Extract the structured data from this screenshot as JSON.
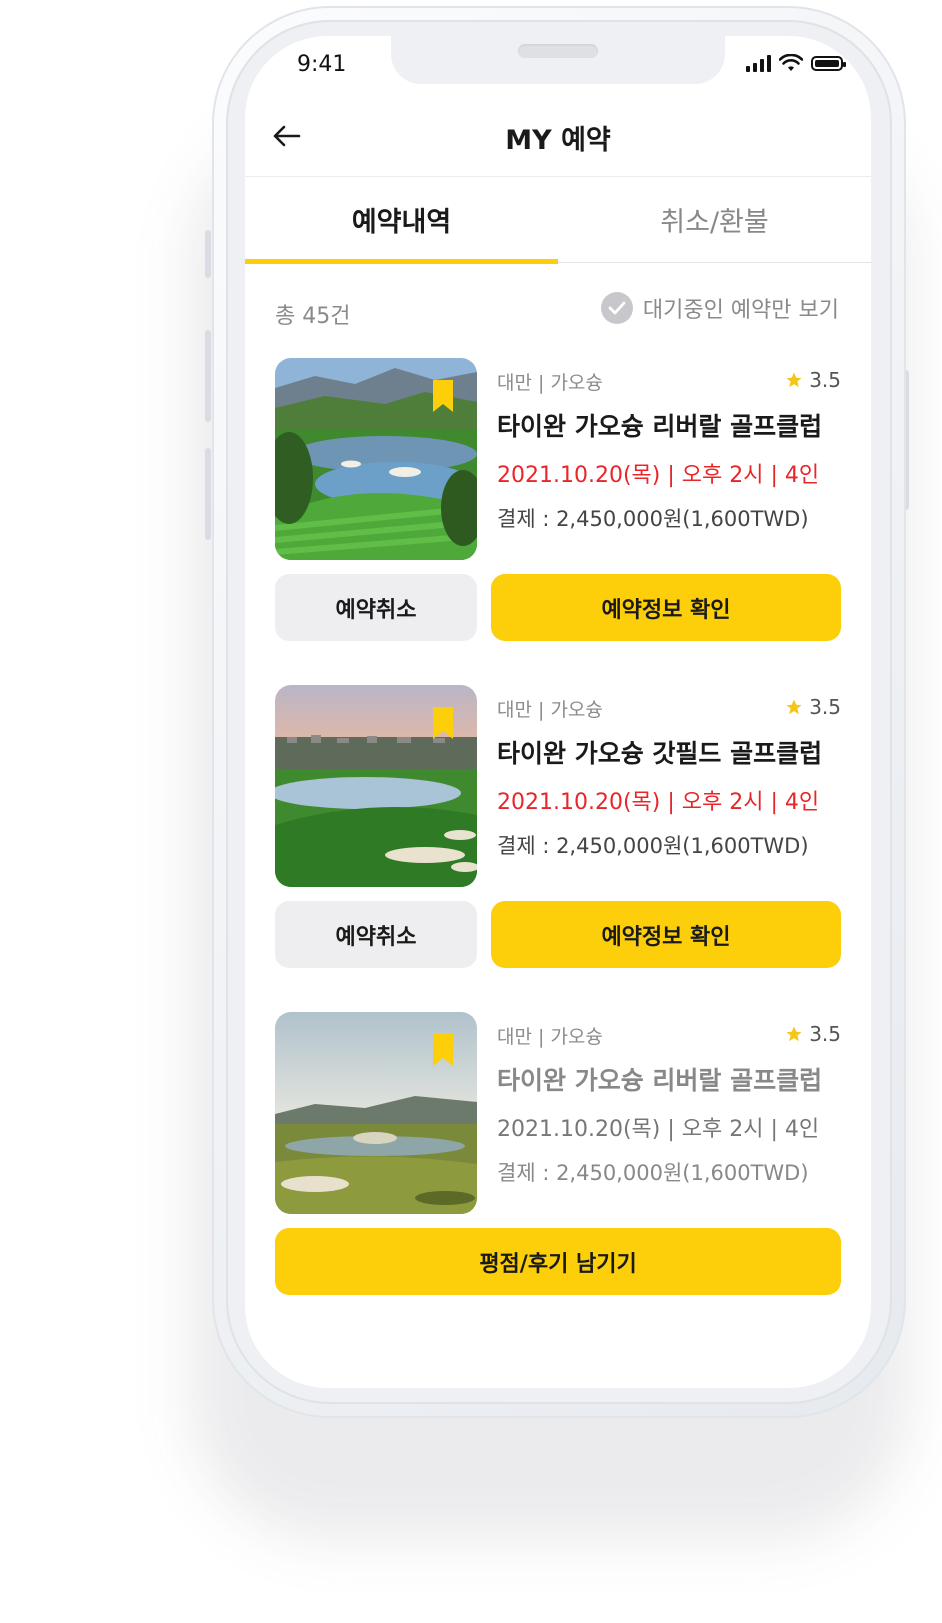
{
  "status": {
    "time": "9:41"
  },
  "header": {
    "title": "MY 예약"
  },
  "tabs": [
    {
      "label": "예약내역",
      "active": true
    },
    {
      "label": "취소/환불",
      "active": false
    }
  ],
  "summary": {
    "count": "총 45건",
    "filter_label": "대기중인 예약만 보기"
  },
  "reservations": [
    {
      "region": "대만 | 가오슝",
      "rating": "3.5",
      "name": "타이완 가오슝 리버랄 골프클럽",
      "date": "2021.10.20(목) | 오후 2시 | 4인",
      "payment": "결제 : 2,450,000원(1,600TWD)",
      "cancel_label": "예약취소",
      "detail_label": "예약정보 확인"
    },
    {
      "region": "대만 | 가오슝",
      "rating": "3.5",
      "name": "타이완 가오슝 갓필드 골프클럽",
      "date": "2021.10.20(목) | 오후 2시 | 4인",
      "payment": "결제 : 2,450,000원(1,600TWD)",
      "cancel_label": "예약취소",
      "detail_label": "예약정보 확인"
    },
    {
      "region": "대만 | 가오슝",
      "rating": "3.5",
      "name": "타이완 가오슝 리버랄 골프클럽",
      "date": "2021.10.20(목) | 오후 2시 | 4인",
      "payment": "결제 : 2,450,000원(1,600TWD)",
      "review_label": "평점/후기 남기기"
    }
  ],
  "colors": {
    "accent": "#fccf0a",
    "date_red": "#e8262a",
    "star": "#f5c518"
  },
  "icons": [
    "back-arrow-icon",
    "signal-icon",
    "wifi-icon",
    "battery-icon",
    "check-circle-icon",
    "bookmark-icon",
    "star-icon"
  ]
}
